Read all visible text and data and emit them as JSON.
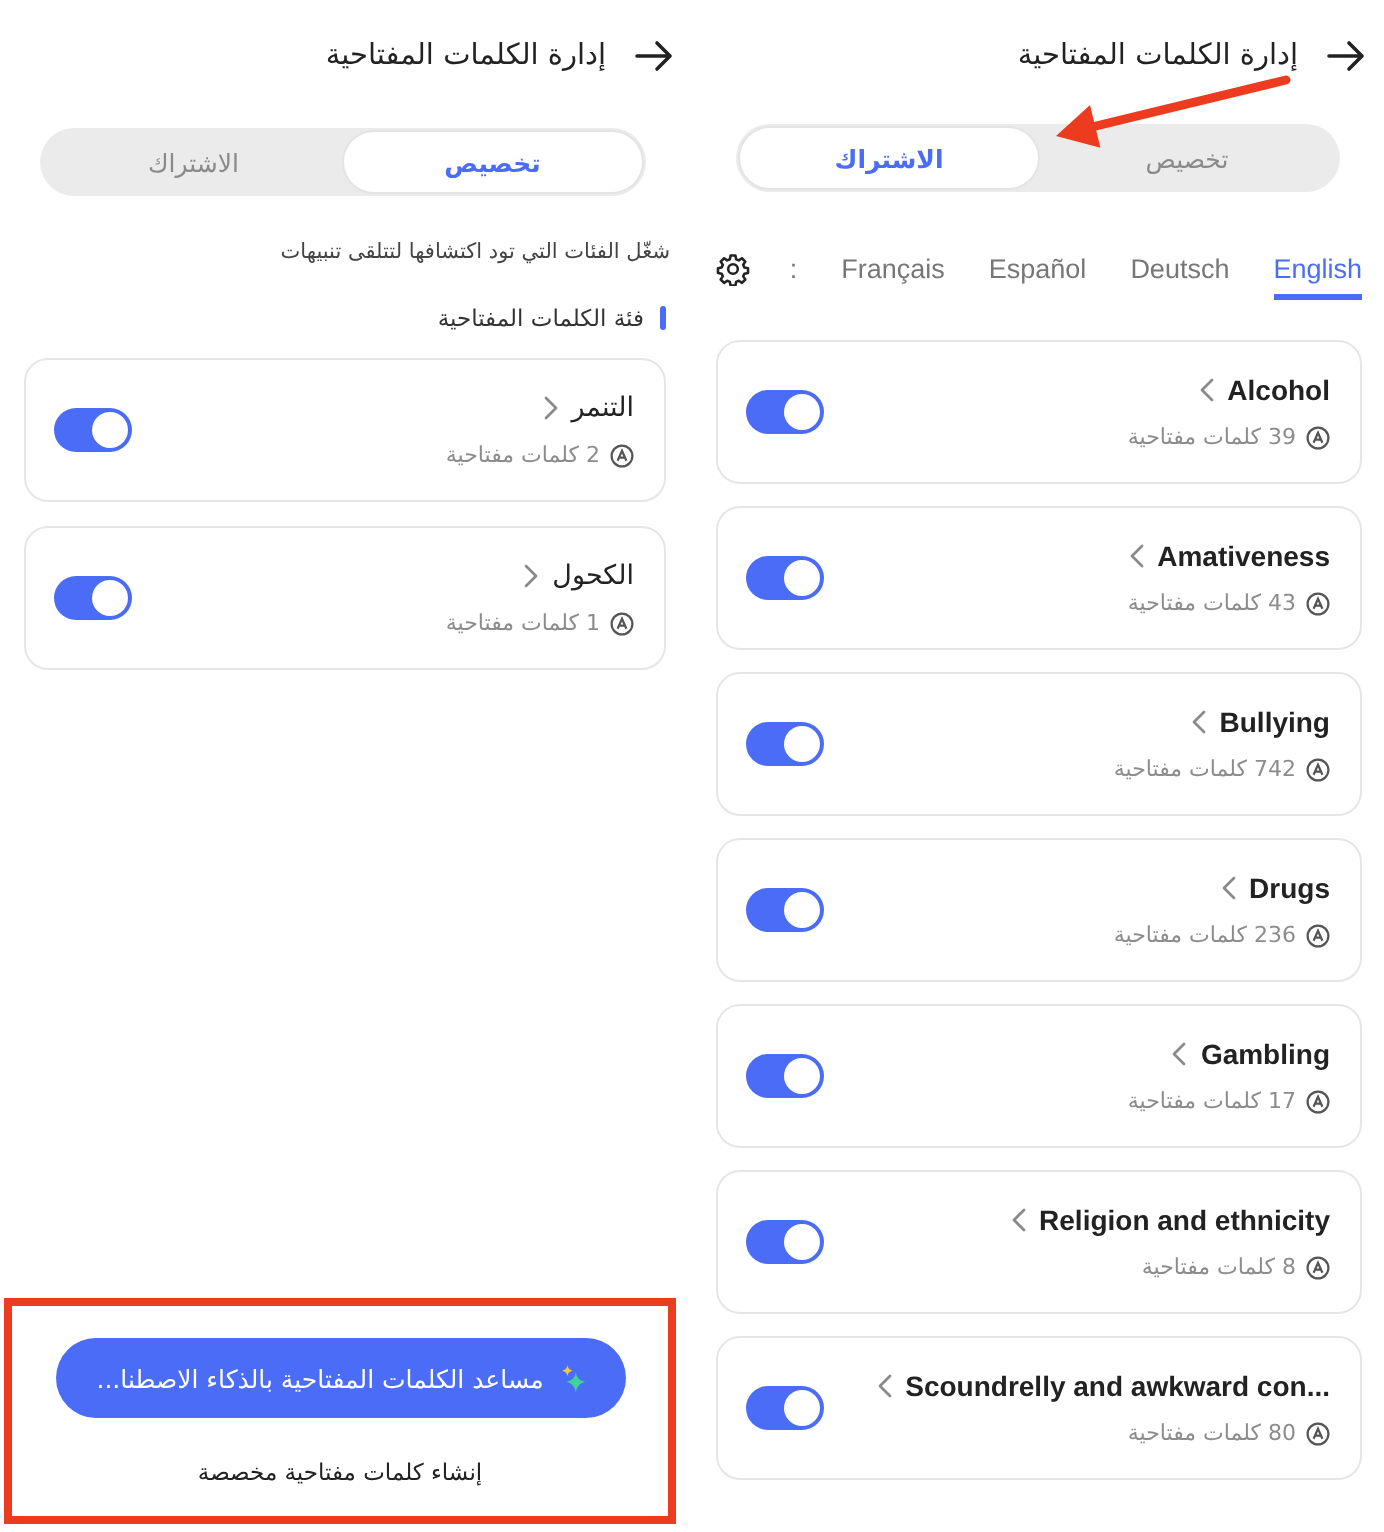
{
  "panels": [
    {
      "header": {
        "title": "إدارة الكلمات المفتاحية"
      },
      "segments": {
        "annotated": true,
        "tabs": [
          {
            "label": "تخصيص",
            "selected": false
          },
          {
            "label": "الاشتراك",
            "selected": true
          }
        ]
      },
      "language_tabs": [
        {
          "label": "English",
          "selected": true
        },
        {
          "label": "Deutsch",
          "selected": false
        },
        {
          "label": "Español",
          "selected": false
        },
        {
          "label": "Français",
          "selected": false
        },
        {
          "label": ":",
          "selected": false
        }
      ],
      "categories": [
        {
          "name": "Alcohol",
          "count": "39 كلمات مفتاحية",
          "on": true
        },
        {
          "name": "Amativeness",
          "count": "43 كلمات مفتاحية",
          "on": true
        },
        {
          "name": "Bullying",
          "count": "742 كلمات مفتاحية",
          "on": true
        },
        {
          "name": "Drugs",
          "count": "236 كلمات مفتاحية",
          "on": true
        },
        {
          "name": "Gambling",
          "count": "17 كلمات مفتاحية",
          "on": true
        },
        {
          "name": "Religion and ethnicity",
          "count": "8 كلمات مفتاحية",
          "on": true
        },
        {
          "name": "Scoundrelly and awkward con...",
          "count": "80 كلمات مفتاحية",
          "on": true
        }
      ]
    },
    {
      "header": {
        "title": "إدارة الكلمات المفتاحية"
      },
      "segments": {
        "annotated": false,
        "tabs": [
          {
            "label": "تخصيص",
            "selected": true
          },
          {
            "label": "الاشتراك",
            "selected": false
          }
        ]
      },
      "description": "شغّل الفئات التي تود اكتشافها لتتلقى تنبيهات",
      "section_title": "فئة الكلمات المفتاحية",
      "categories": [
        {
          "name": "التنمر",
          "count": "2 كلمات مفتاحية",
          "on": true
        },
        {
          "name": "الكحول",
          "count": "1 كلمات مفتاحية",
          "on": true
        }
      ],
      "footer": {
        "annotated": true,
        "ai_button": "مساعد الكلمات المفتاحية بالذكاء الاصطنا...",
        "create_link": "إنشاء كلمات مفتاحية مخصصة"
      }
    }
  ]
}
